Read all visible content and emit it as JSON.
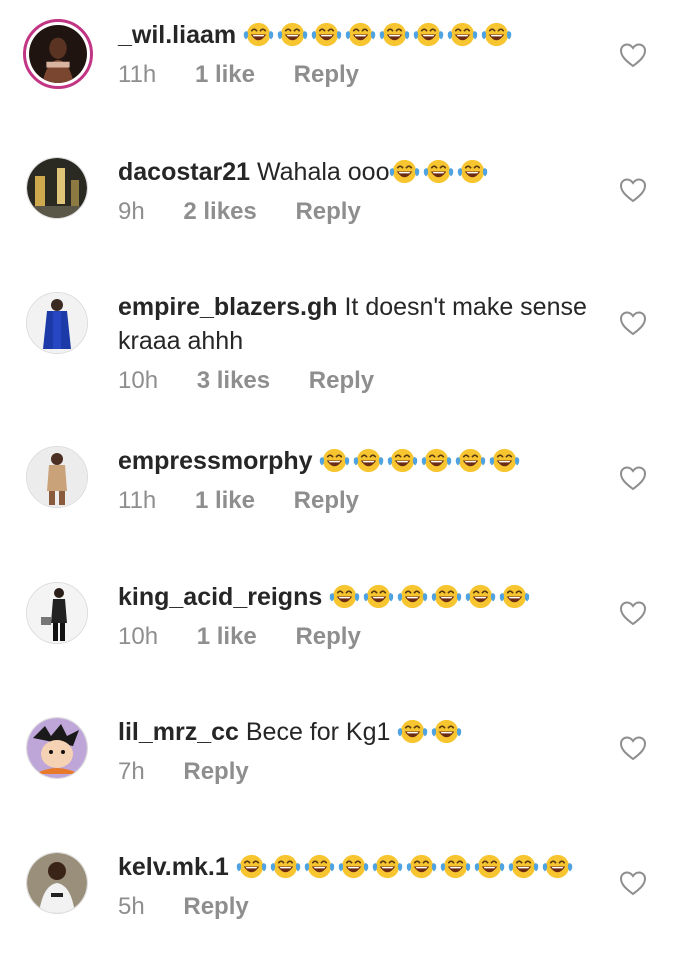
{
  "comments": [
    {
      "username": "_wil.liaam",
      "text": "",
      "emoji_count": 8,
      "time": "11h",
      "likes": "1 like",
      "reply": "Reply"
    },
    {
      "username": "dacostar21",
      "text": "Wahala ooo",
      "emoji_count": 3,
      "time": "9h",
      "likes": "2 likes",
      "reply": "Reply"
    },
    {
      "username": "empire_blazers.gh",
      "text": "It doesn't make sense kraaa ahhh",
      "emoji_count": 0,
      "time": "10h",
      "likes": "3 likes",
      "reply": "Reply"
    },
    {
      "username": "empressmorphy",
      "text": "",
      "emoji_count": 6,
      "time": "11h",
      "likes": "1 like",
      "reply": "Reply"
    },
    {
      "username": "king_acid_reigns",
      "text": "",
      "emoji_count": 6,
      "time": "10h",
      "likes": "1 like",
      "reply": "Reply"
    },
    {
      "username": "lil_mrz_cc",
      "text": "Bece for Kg1",
      "emoji_count": 2,
      "time": "7h",
      "likes": "",
      "reply": "Reply"
    },
    {
      "username": "kelv.mk.1",
      "text": "",
      "emoji_count": 10,
      "time": "5h",
      "likes": "",
      "reply": "Reply"
    }
  ],
  "icons": {
    "emoji": "face-with-tears-of-joy-icon",
    "like": "heart-outline-icon"
  },
  "colors": {
    "text": "#262626",
    "meta": "#8e8e8e",
    "story_ring": "#c13584",
    "emoji_face": "#f7c530",
    "emoji_tears": "#4fa3e0"
  }
}
